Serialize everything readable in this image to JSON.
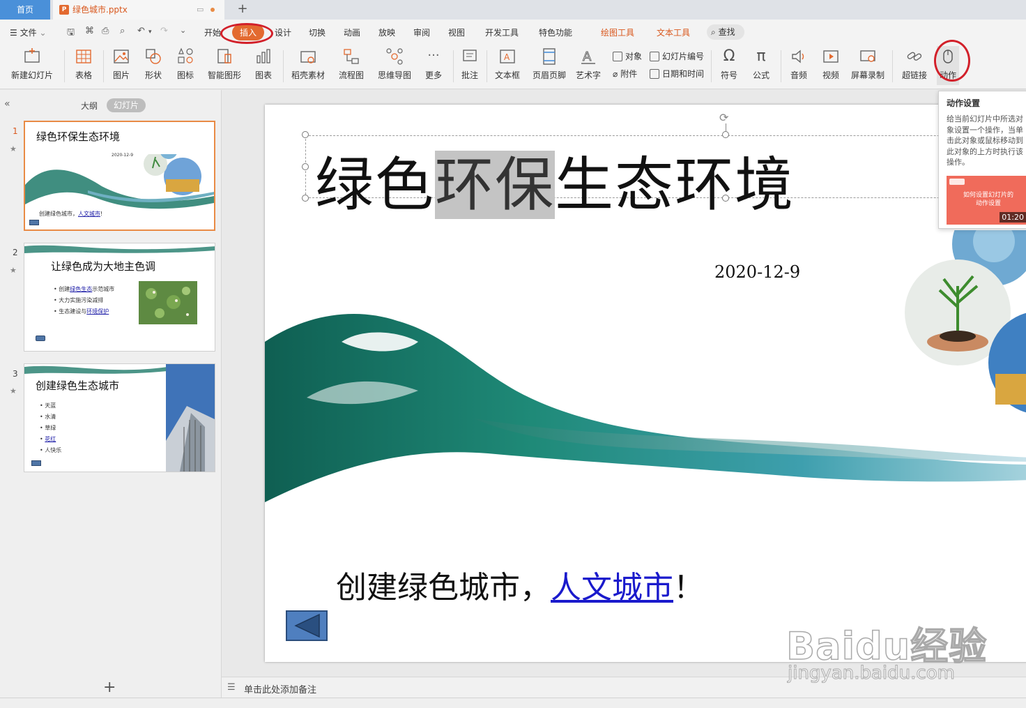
{
  "tabs": {
    "home": "首页",
    "document": "绿色城市.pptx"
  },
  "menu": {
    "file": "文件",
    "items": [
      "开始",
      "插入",
      "设计",
      "切换",
      "动画",
      "放映",
      "审阅",
      "视图",
      "开发工具",
      "特色功能"
    ],
    "context_tools": [
      "绘图工具",
      "文本工具"
    ],
    "search": "查找",
    "active": "插入"
  },
  "ribbon": {
    "new_slide": "新建幻灯片",
    "table": "表格",
    "picture": "图片",
    "shape": "形状",
    "icon": "图标",
    "smartart": "智能图形",
    "chart": "图表",
    "daoke": "稻壳素材",
    "flowchart": "流程图",
    "mindmap": "思维导图",
    "more": "更多",
    "comment": "批注",
    "textbox": "文本框",
    "header_footer": "页眉页脚",
    "wordart": "艺术字",
    "object": "对象",
    "attachment": "附件",
    "slide_number": "幻灯片编号",
    "datetime": "日期和时间",
    "symbol": "符号",
    "formula": "公式",
    "audio": "音频",
    "video": "视频",
    "screen_record": "屏幕录制",
    "hyperlink": "超链接",
    "action": "动作"
  },
  "left_panel": {
    "outline_tab": "大纲",
    "slides_tab": "幻灯片",
    "add": "+",
    "slides": [
      {
        "number": "1",
        "title": "绿色环保生态环境",
        "date": "2020-12-9",
        "line_text": "创建绿色城市，",
        "line_link": "人文城市",
        "line_end": "!"
      },
      {
        "number": "2",
        "title": "让绿色成为大地主色调",
        "bullets": [
          {
            "pre": "创建",
            "link": "绿色生态",
            "post": "示范城市"
          },
          {
            "pre": "大力实施污染减排",
            "link": "",
            "post": ""
          },
          {
            "pre": "生态建设与",
            "link": "环境保护",
            "post": ""
          }
        ]
      },
      {
        "number": "3",
        "title": "创建绿色生态城市",
        "bullets": [
          "天蓝",
          "水清",
          "草绿",
          "花红",
          "人快乐"
        ],
        "link_bullet_index": 3
      }
    ]
  },
  "slide": {
    "title_pre": "绿色",
    "title_highlight": "环保",
    "title_post": "生态环境",
    "date": "2020-12-9",
    "subtitle_pre": "创建绿色城市，",
    "subtitle_link": "人文城市",
    "subtitle_post": "！"
  },
  "notes": {
    "placeholder": "单击此处添加备注"
  },
  "tooltip": {
    "title": "动作设置",
    "description": "给当前幻灯片中所选对象设置一个操作，当单击此对象或鼠标移动到此对象的上方时执行该操作。",
    "video_title": "如何设置幻灯片的动作设置",
    "video_duration": "01:20"
  },
  "watermark": {
    "main": "Baidu经验",
    "sub": "jingyan.baidu.com"
  },
  "colors": {
    "accent": "#e36a30",
    "annotation": "#d2202a",
    "home_tab": "#4a90d9",
    "link": "#1a1acc"
  }
}
